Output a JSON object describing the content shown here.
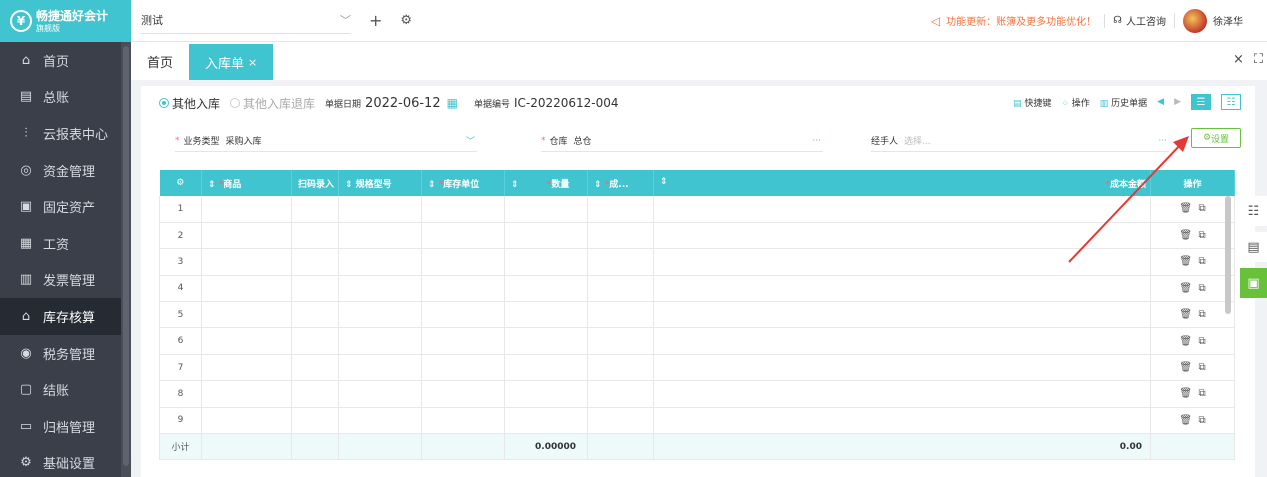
{
  "app": {
    "logo_text": "畅捷通好会计",
    "logo_edition": "旗舰版"
  },
  "sidebar": {
    "items": [
      {
        "label": "首页",
        "icon": "home-icon"
      },
      {
        "label": "总账",
        "icon": "ledger-icon"
      },
      {
        "label": "云报表中心",
        "icon": "chart-icon"
      },
      {
        "label": "资金管理",
        "icon": "money-icon"
      },
      {
        "label": "固定资产",
        "icon": "asset-icon"
      },
      {
        "label": "工资",
        "icon": "salary-icon"
      },
      {
        "label": "发票管理",
        "icon": "invoice-icon"
      },
      {
        "label": "库存核算",
        "icon": "warehouse-icon",
        "active": true
      },
      {
        "label": "税务管理",
        "icon": "tax-icon"
      },
      {
        "label": "结账",
        "icon": "close-books-icon"
      },
      {
        "label": "归档管理",
        "icon": "archive-icon"
      },
      {
        "label": "基础设置",
        "icon": "settings-icon"
      }
    ]
  },
  "header": {
    "account": "测试",
    "notice": "功能更新：账簿及更多功能优化！",
    "support": "人工咨询",
    "user": "徐泽华"
  },
  "tabs": [
    {
      "label": "首页"
    },
    {
      "label": "入库单",
      "active": true
    }
  ],
  "form": {
    "type_options": [
      "其他入库",
      "其他入库退库"
    ],
    "date_label": "单据日期",
    "date": "2022-06-12",
    "no_label": "单据编号",
    "no": "IC-20220612-004",
    "tools": {
      "shortcut": "快捷键",
      "ops": "操作",
      "history": "历史单据"
    },
    "biz_type_label": "业务类型",
    "biz_type": "采购入库",
    "warehouse_label": "仓库",
    "warehouse": "总仓",
    "handler_label": "经手人",
    "handler_placeholder": "选择...",
    "settings": "设置"
  },
  "table": {
    "headers": [
      "商品",
      "扫码录入",
      "规格型号",
      "库存单位",
      "数量",
      "成...",
      "成本金额",
      "操作"
    ],
    "rows": [
      "1",
      "2",
      "3",
      "4",
      "5",
      "6",
      "7",
      "8",
      "9"
    ],
    "subtotal_label": "小计",
    "subtotal_qty": "0.00000",
    "subtotal_amount": "0.00"
  },
  "colors": {
    "accent": "#40c4d0",
    "sidebar": "#3b3f4a",
    "notice": "#f5733c",
    "settings": "#67c23a",
    "arrow": "#e53935"
  }
}
